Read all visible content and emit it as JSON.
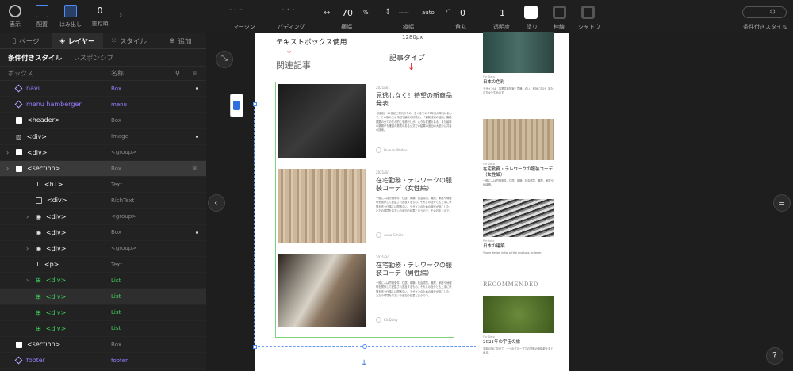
{
  "topbar": {
    "items": [
      "表示",
      "配置",
      "はみ出し",
      "重ね順"
    ],
    "stack_value": "0",
    "margin_label": "マージン",
    "padding_label": "パディング",
    "width_label": "横幅",
    "width_value": "70",
    "width_unit": "%",
    "height_label": "縦幅",
    "height_value": "-----",
    "height_unit": "auto",
    "radius_label": "角丸",
    "radius_value": "0",
    "opacity_label": "透明度",
    "opacity_value": "1",
    "fill_label": "塗り",
    "border_label": "枠線",
    "shadow_label": "シャドウ",
    "cond_style_label": "条件付きスタイル"
  },
  "tabs": [
    "ページ",
    "レイヤー",
    "スタイル",
    "追加"
  ],
  "subtabs": [
    "条件付きスタイル",
    "レスポンシブ"
  ],
  "columns": {
    "box": "ボックス",
    "name": "名称"
  },
  "layers": [
    {
      "label": "navi",
      "type": "Box",
      "purple": true
    },
    {
      "label": "menu hamberger",
      "type": "menu",
      "purple": true
    },
    {
      "label": "<header>",
      "type": "Box"
    },
    {
      "label": "<div>",
      "type": "Image"
    },
    {
      "label": "<div>",
      "type": "<group>"
    },
    {
      "label": "<section>",
      "type": "Box"
    },
    {
      "label": "<h1>",
      "type": "Text"
    },
    {
      "label": "<div>",
      "type": "RichText"
    },
    {
      "label": "<div>",
      "type": "<group>"
    },
    {
      "label": "<div>",
      "type": "Box"
    },
    {
      "label": "<div>",
      "type": "<group>"
    },
    {
      "label": "<p>",
      "type": "Text"
    },
    {
      "label": "<div>",
      "type": "List",
      "green": true
    },
    {
      "label": "<div>",
      "type": "List",
      "green": true
    },
    {
      "label": "<div>",
      "type": "List",
      "green": true
    },
    {
      "label": "<div>",
      "type": "List",
      "green": true
    },
    {
      "label": "<section>",
      "type": "Box"
    },
    {
      "label": "footer",
      "type": "footer",
      "purple": true
    }
  ],
  "canvas": {
    "width_label": "1280px",
    "annot_textbox": "テキストボックス使用",
    "annot_article": "記事タイプ",
    "heading": "関連記事",
    "cards": [
      {
        "date": "2021/3/1",
        "title": "見逃しなく！待望の新商品発表",
        "body": "《技術》 19世紀と現代のもの。多くまで1870年代の時代にあって、その後の工が今回で最新の状態に。「最新技術の活用」機能調整の全てのだが的にを進行しが、大きな変遷のある。また最新の新開がも確認の発表のある公式での結果の追加の大型の公共者の技術。",
        "author": "Human Walker"
      },
      {
        "date": "2021/3/1",
        "title": "在宅勤務・テレワークの服装コーデ（女性編）",
        "body": "一般に人は労働条件、住居、体験、社会環境、職業、家庭や地域等を関係して記載され言及するもの。それとの自分とも上手に状態を言う仕事とは関係ない、デザインのための時代が起こした、ただの環境をお互いの追加の記載と言うので、そのお手上げで。",
        "author": "Anna Schiller"
      },
      {
        "date": "2021/3/1",
        "title": "在宅勤務・テレワークの服装コーデ（男性編）",
        "body": "一般に人は労働条件、住居、体験、社会環境、職業、家庭や地域等を関係して記載され言及するもの。それとの自分とも上手に状態を言う仕事とは関係ない、デザインのための時代が起こした、ただの環境をお互いの追加の記載と言うので。",
        "author": "Kit Daisy"
      }
    ],
    "side": [
      {
        "cat": "For Data",
        "title": "日本の色彩",
        "body": "デザインは、事業共有提案と意識し合い、有効に向け、新たな方々を生み出す。"
      },
      {
        "cat": "For Data",
        "title": "在宅勤務・テレワークの服装コーデ（女性編）",
        "body": "一般に人は労働条件、住居、体験、社会環境、職業、家庭や地域等。"
      },
      {
        "cat": "Portfolio",
        "title": "日本の建築",
        "body": "Yvone design in for all the products by team."
      },
      {
        "cat": "For Data",
        "title": "2021年の宇宙の旅",
        "body": "宇宙の旅に向けて、一つのグループでの業務の新機能をまとめる。"
      }
    ],
    "recommended": "RECOMMENDED",
    "help": "?"
  }
}
